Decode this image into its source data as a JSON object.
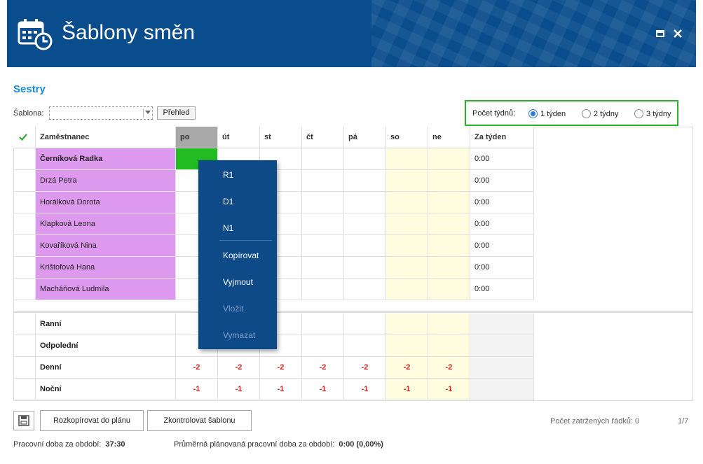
{
  "window": {
    "title": "Šablony směn",
    "maximize_icon": "maximize-icon",
    "close_icon": "close-icon",
    "header_color": "#0a4d8c"
  },
  "section": {
    "title": "Sestry"
  },
  "template": {
    "label": "Šablona:",
    "value": "",
    "overview_button": "Přehled"
  },
  "weeks": {
    "label": "Počet týdnů:",
    "options": [
      "1 týden",
      "2 týdny",
      "3 týdny"
    ],
    "selected": "1 týden",
    "highlight_color": "#2bb02b"
  },
  "table": {
    "check_icon": "checkmark-icon",
    "headers": {
      "employee": "Zaměstnanec",
      "days": [
        "po",
        "út",
        "st",
        "čt",
        "pá",
        "so",
        "ne"
      ],
      "week_total": "Za týden"
    },
    "employees": [
      {
        "name": "Černíková Radka",
        "total": "0:00",
        "bold": true
      },
      {
        "name": "Drzá Petra",
        "total": "0:00"
      },
      {
        "name": "Horálková Dorota",
        "total": "0:00"
      },
      {
        "name": "Klapková Leona",
        "total": "0:00"
      },
      {
        "name": "Kovaříková Nina",
        "total": "0:00"
      },
      {
        "name": "Krištofová Hana",
        "total": "0:00"
      },
      {
        "name": "Macháňová Ludmila",
        "total": "0:00"
      }
    ],
    "summary": [
      {
        "label": "Ranní",
        "values": [
          "",
          "",
          "",
          "",
          "",
          "",
          ""
        ]
      },
      {
        "label": "Odpolední",
        "values": [
          "",
          "",
          "",
          "",
          "",
          "",
          ""
        ]
      },
      {
        "label": "Denní",
        "values": [
          "-2",
          "-2",
          "-2",
          "-2",
          "-2",
          "-2",
          "-2"
        ]
      },
      {
        "label": "Noční",
        "values": [
          "-1",
          "-1",
          "-1",
          "-1",
          "-1",
          "-1",
          "-1"
        ]
      }
    ],
    "colors": {
      "employee_bg": "#dd99ee",
      "weekend_bg": "#fffde0",
      "selected_cell": "#22bb22",
      "negative": "#dd2222"
    }
  },
  "context_menu": {
    "items": [
      {
        "label": "R1",
        "enabled": true
      },
      {
        "label": "D1",
        "enabled": true
      },
      {
        "label": "N1",
        "enabled": true
      },
      {
        "label": "Kopírovat",
        "enabled": true
      },
      {
        "label": "Vyjmout",
        "enabled": true
      },
      {
        "label": "Vložit",
        "enabled": false
      },
      {
        "label": "Vymazat",
        "enabled": false
      }
    ]
  },
  "footer": {
    "save_icon": "save-icon",
    "copy_to_plan": "Rozkopírovat do plánu",
    "check_template": "Zkontrolovat šablonu",
    "marked_rows": "Počet zatržených řádků: 0",
    "paging": "1/7",
    "work_time_label": "Pracovní doba za období:",
    "work_time_value": "37:30",
    "avg_time_label": "Průměrná plánovaná pracovní doba za období:",
    "avg_time_value": "0:00 (0,00%)"
  }
}
